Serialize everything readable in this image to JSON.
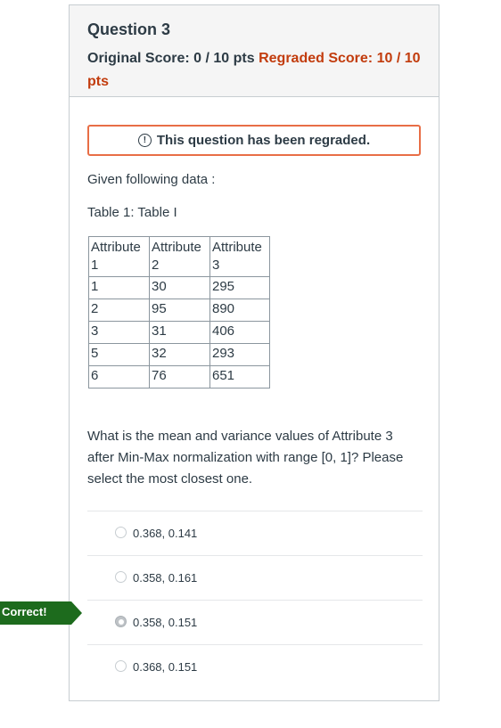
{
  "question": {
    "title": "Question 3",
    "original_score_label": "Original Score:",
    "original_score": "0 / 10 pts",
    "regraded_score_label": "Regraded Score:",
    "regraded_score": "10 / 10 pts"
  },
  "banner": {
    "icon": "alert-circle-icon",
    "text": "This question has been regraded."
  },
  "body": {
    "intro": "Given following data :",
    "table_caption": "Table 1: Table I",
    "table": {
      "headers": [
        "Attribute 1",
        "Attribute 2",
        "Attribute 3"
      ],
      "rows": [
        [
          "1",
          "30",
          "295"
        ],
        [
          "2",
          "95",
          "890"
        ],
        [
          "3",
          "31",
          "406"
        ],
        [
          "5",
          "32",
          "293"
        ],
        [
          "6",
          "76",
          "651"
        ]
      ]
    },
    "question_text": "What is the mean and variance values of Attribute 3 after Min-Max normalization with range [0, 1]? Please select the most closest one."
  },
  "answers": [
    {
      "label": "0.368, 0.141",
      "selected": false
    },
    {
      "label": "0.358, 0.161",
      "selected": false
    },
    {
      "label": "0.358, 0.151",
      "selected": true
    },
    {
      "label": "0.368, 0.151",
      "selected": false
    }
  ],
  "feedback": {
    "correct_label": "Correct!",
    "color": "#1d6b1d"
  },
  "colors": {
    "regraded": "#c23c0d",
    "banner_border": "#e86e46"
  }
}
